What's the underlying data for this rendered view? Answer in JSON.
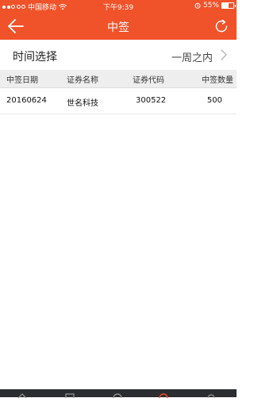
{
  "status_bar": {
    "carrier": "中国移动",
    "time": "下午9:39",
    "battery": "55%",
    "battery_level": 0.55
  },
  "nav": {
    "title": "中签",
    "back_icon": "arrow-left-icon",
    "refresh_icon": "refresh-icon"
  },
  "filter": {
    "label": "时间选择",
    "value": "一周之内",
    "icon": "chevron-right-icon"
  },
  "table": {
    "headers": [
      "中签日期",
      "证券名称",
      "证券代码",
      "中签数量"
    ],
    "rows": [
      [
        "20160624",
        "世名科技",
        "300522",
        "500"
      ]
    ]
  },
  "colors": {
    "brand": "#f0522a",
    "header_bg": "#eeeeee",
    "tab_bar": "#2b2d31"
  }
}
